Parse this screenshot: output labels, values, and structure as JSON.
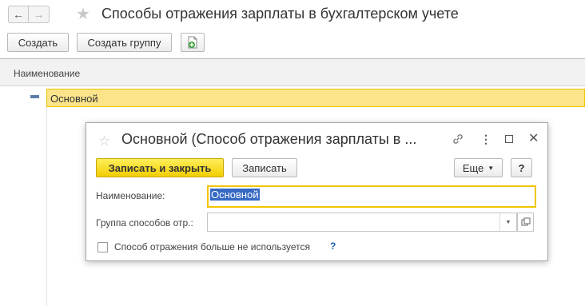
{
  "window": {
    "title": "Способы отражения зарплаты в бухгалтерском учете",
    "back_icon": "←",
    "forward_icon": "→",
    "star_icon": "★"
  },
  "toolbar": {
    "create_label": "Создать",
    "create_group_label": "Создать группу"
  },
  "list": {
    "column_header": "Наименование",
    "rows": [
      {
        "label": "Основной"
      }
    ]
  },
  "dialog": {
    "title": "Основной (Способ отражения зарплаты в ...",
    "save_close_label": "Записать и закрыть",
    "save_label": "Записать",
    "more_label": "Еще",
    "help_label": "?",
    "name_label": "Наименование:",
    "name_value": "Основной",
    "group_label": "Группа способов отр.:",
    "group_value": "",
    "checkbox_label": "Способ отражения больше не используется",
    "checkbox_checked": false,
    "checkbox_help": "?"
  },
  "colors": {
    "accent_yellow": "#f2cd00",
    "selection_row": "#fbe48a",
    "text_selection": "#3569c4",
    "help_link": "#1a5fb4"
  }
}
